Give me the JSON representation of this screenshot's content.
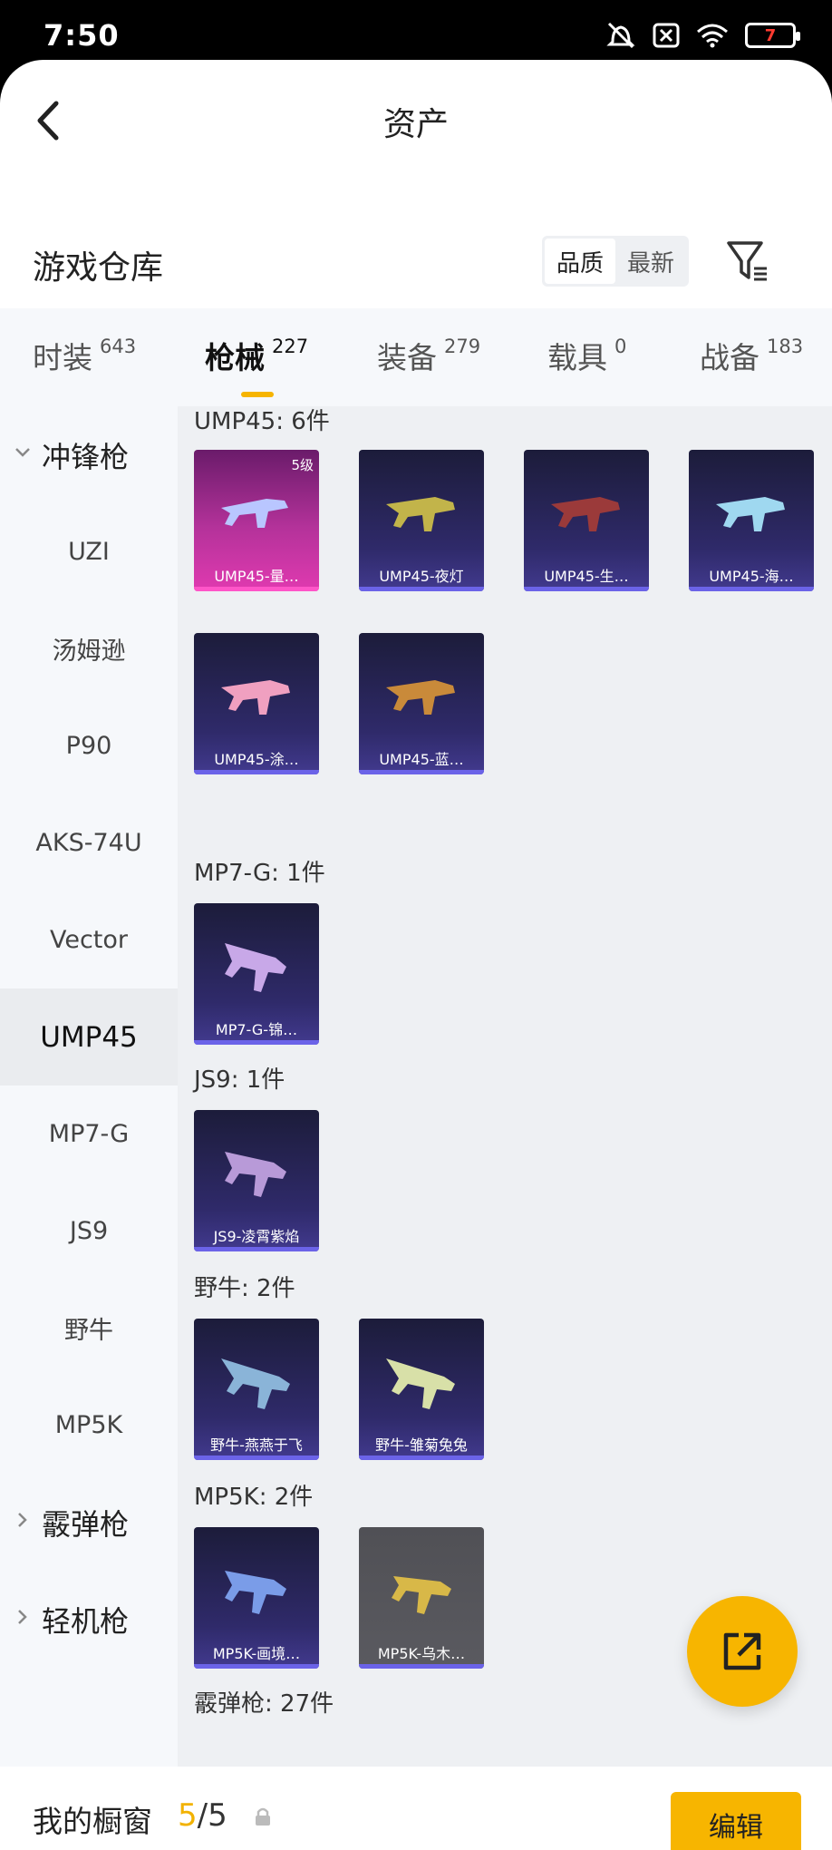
{
  "status_bar": {
    "time": "7:50",
    "battery": "7"
  },
  "header": {
    "title": "资产"
  },
  "warehouse": {
    "title": "游戏仓库",
    "sort_options": [
      "品质",
      "最新"
    ]
  },
  "tabs": [
    {
      "label": "时装",
      "count": "643"
    },
    {
      "label": "枪械",
      "count": "227"
    },
    {
      "label": "装备",
      "count": "279"
    },
    {
      "label": "载具",
      "count": "0"
    },
    {
      "label": "战备",
      "count": "183"
    }
  ],
  "sidebar": {
    "groups": [
      "冲锋枪",
      "霰弹枪",
      "轻机枪"
    ],
    "items": [
      "UZI",
      "汤姆逊",
      "P90",
      "AKS-74U",
      "Vector",
      "UMP45",
      "MP7-G",
      "JS9",
      "野牛",
      "MP5K"
    ],
    "active": "UMP45"
  },
  "sections": [
    {
      "title": "UMP45: 6件",
      "items": [
        "UMP45-量…",
        "UMP45-夜灯",
        "UMP45-生…",
        "UMP45-海…",
        "UMP45-涂…",
        "UMP45-蓝…"
      ],
      "first_level": "5级"
    },
    {
      "title": "MP7-G: 1件",
      "items": [
        "MP7-G-锦…"
      ]
    },
    {
      "title": "JS9: 1件",
      "items": [
        "JS9-凌霄紫焰"
      ]
    },
    {
      "title": "野牛: 2件",
      "items": [
        "野牛-燕燕于飞",
        "野牛-雏菊兔兔"
      ]
    },
    {
      "title": "MP5K: 2件",
      "items": [
        "MP5K-画境…",
        "MP5K-乌木…"
      ]
    },
    {
      "title": "霰弹枪: 27件"
    }
  ],
  "bottom_bar": {
    "label": "我的橱窗",
    "count_current": "5",
    "count_total": "/5",
    "edit_label": "编辑"
  },
  "colors": {
    "accent": "#f7b500"
  }
}
